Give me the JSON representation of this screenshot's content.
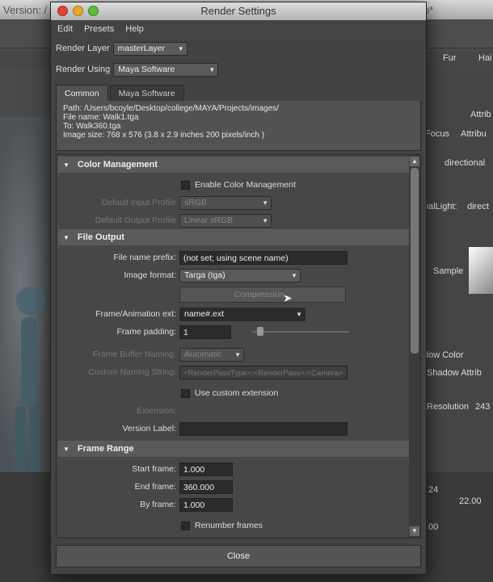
{
  "background": {
    "title_left": "Version: /",
    "title_right": "k.mb*",
    "right_panel": [
      "Attrib",
      "Focus",
      "Attribu",
      "directional",
      "nalLight:",
      "direct",
      "Sample",
      "dow Color",
      "Shadow Attrib",
      "Resolution",
      "243",
      "Fur",
      "Hai"
    ],
    "bottom_values": [
      "22.00",
      "00",
      "24"
    ]
  },
  "window": {
    "title": "Render Settings",
    "menu": [
      "Edit",
      "Presets",
      "Help"
    ],
    "render_layer_label": "Render Layer",
    "render_layer_value": "masterLayer",
    "render_using_label": "Render Using",
    "render_using_value": "Maya Software",
    "tabs": [
      "Common",
      "Maya Software"
    ],
    "info": {
      "path": "Path: /Users/bcoyle/Desktop/college/MAYA/Projects/images/",
      "file_name": "File name:  Walk1.tga",
      "to": "To:          Walk360.tga",
      "image_size": "Image size: 768 x 576 (3.8 x 2.9 inches 200 pixels/inch )"
    },
    "color_management": {
      "title": "Color Management",
      "enable_label": "Enable Color Management",
      "input_profile_label": "Default Input Profile",
      "input_profile_value": "sRGB",
      "output_profile_label": "Default Output Profile",
      "output_profile_value": "Linear sRGB"
    },
    "file_output": {
      "title": "File Output",
      "prefix_label": "File name prefix:",
      "prefix_value": "(not set; using scene name)",
      "format_label": "Image format:",
      "format_value": "Targa (tga)",
      "compression_label": "Compression...",
      "frame_ext_label": "Frame/Animation ext:",
      "frame_ext_value": "name#.ext",
      "padding_label": "Frame padding:",
      "padding_value": "1",
      "buffer_label": "Frame Buffer Naming:",
      "buffer_value": "Automatic",
      "custom_naming_label": "Custom Naming String:",
      "custom_naming_value": "<RenderPassType>:<RenderPass>.<Camera>",
      "use_custom_ext_label": "Use custom extension",
      "extension_label": "Extension:",
      "version_label": "Version Label:"
    },
    "frame_range": {
      "title": "Frame Range",
      "start_label": "Start frame:",
      "start_value": "1.000",
      "end_label": "End frame:",
      "end_value": "360.000",
      "by_label": "By frame:",
      "by_value": "1.000",
      "renumber_label": "Renumber frames"
    },
    "close_label": "Close"
  }
}
